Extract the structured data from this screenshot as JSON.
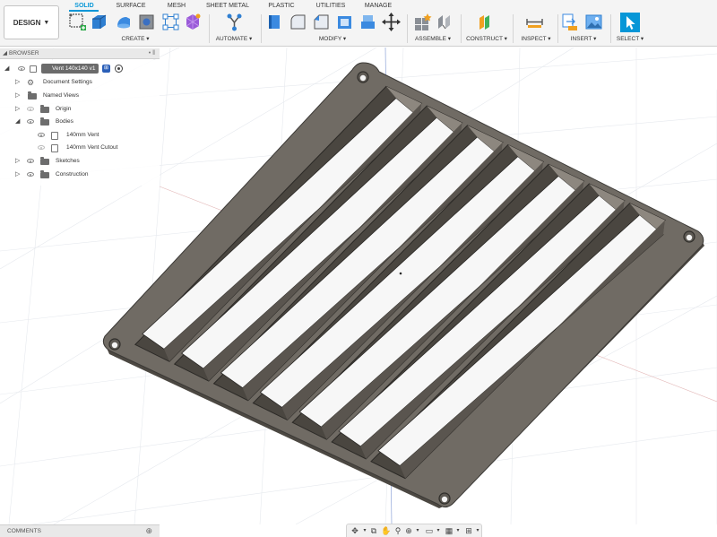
{
  "workspace": {
    "label": "DESIGN"
  },
  "tabs": [
    {
      "label": "SOLID",
      "active": true
    },
    {
      "label": "SURFACE",
      "active": false
    },
    {
      "label": "MESH",
      "active": false
    },
    {
      "label": "SHEET METAL",
      "active": false
    },
    {
      "label": "PLASTIC",
      "active": false
    },
    {
      "label": "UTILITIES",
      "active": false
    },
    {
      "label": "MANAGE",
      "active": false
    }
  ],
  "groups": [
    {
      "label": "CREATE ▾"
    },
    {
      "label": "AUTOMATE ▾"
    },
    {
      "label": "MODIFY ▾"
    },
    {
      "label": "ASSEMBLE ▾"
    },
    {
      "label": "CONSTRUCT ▾"
    },
    {
      "label": "INSPECT ▾"
    },
    {
      "label": "INSERT ▾"
    },
    {
      "label": "SELECT ▾"
    }
  ],
  "browser": {
    "title": "BROWSER",
    "root": "Vent 140x140 v1",
    "items": [
      {
        "label": "Document Settings"
      },
      {
        "label": "Named Views"
      },
      {
        "label": "Origin"
      },
      {
        "label": "Bodies"
      },
      {
        "label": "140mm Vent"
      },
      {
        "label": "140mm Vent Cutout"
      },
      {
        "label": "Sketches"
      },
      {
        "label": "Construction"
      }
    ]
  },
  "comments": {
    "title": "COMMENTS"
  },
  "colors": {
    "accent": "#0696d7",
    "part_face": "#6f6a63",
    "part_edge": "#3a3835",
    "viewport_bg": "#ffffff"
  },
  "icons": [
    "new-sketch-icon",
    "extrude-icon",
    "revolve-icon",
    "hole-icon",
    "form-icon",
    "pattern-icon",
    "automate-icon",
    "press-pull-icon",
    "fillet-icon",
    "chamfer-icon",
    "shell-icon",
    "move-icon",
    "new-component-icon",
    "joint-icon",
    "offset-plane-icon",
    "measure-icon",
    "insert-derive-icon",
    "insert-image-icon",
    "select-icon"
  ]
}
